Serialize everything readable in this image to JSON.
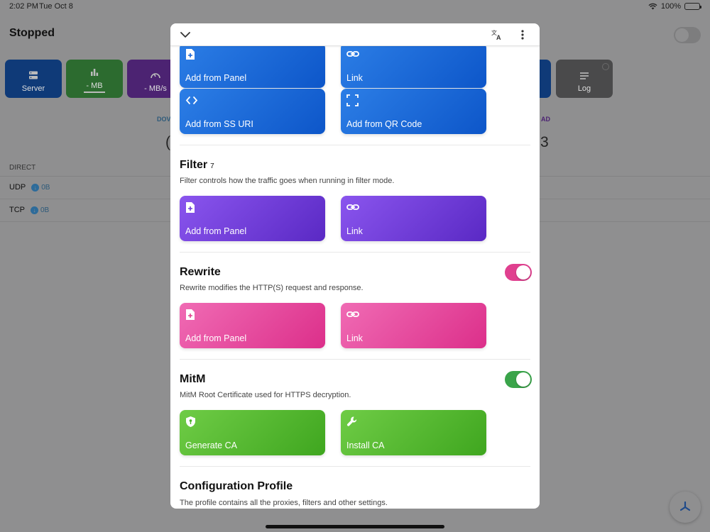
{
  "status_bar": {
    "time": "2:02 PM",
    "date": "Tue Oct 8",
    "battery": "100%"
  },
  "background": {
    "title": "Stopped",
    "tiles": {
      "server": "Server",
      "mb": "- MB",
      "mbs": "- MB/s",
      "log": "Log"
    },
    "download_label": "DOV",
    "upload_label": "AD",
    "big_left": "(",
    "big_right": "3",
    "direct_label": "DIRECT",
    "rows": [
      {
        "name": "UDP",
        "amount": "0B"
      },
      {
        "name": "TCP",
        "amount": "0B"
      }
    ]
  },
  "sheet": {
    "server_buttons": [
      {
        "label": "Add from Panel",
        "icon": "file-plus-icon"
      },
      {
        "label": "Link",
        "icon": "link-icon"
      },
      {
        "label": "Add from SS URI",
        "icon": "code-icon"
      },
      {
        "label": "Add from QR Code",
        "icon": "qr-scan-icon"
      }
    ],
    "filter": {
      "title": "Filter",
      "count": "7",
      "description": "Filter controls how the traffic goes when running in filter mode.",
      "buttons": [
        {
          "label": "Add from Panel",
          "icon": "file-plus-icon"
        },
        {
          "label": "Link",
          "icon": "link-icon"
        }
      ]
    },
    "rewrite": {
      "title": "Rewrite",
      "enabled": true,
      "description": "Rewrite modifies the HTTP(S) request and response.",
      "buttons": [
        {
          "label": "Add from Panel",
          "icon": "file-plus-icon"
        },
        {
          "label": "Link",
          "icon": "link-icon"
        }
      ]
    },
    "mitm": {
      "title": "MitM",
      "enabled": true,
      "description": "MitM Root Certificate used for HTTPS decryption.",
      "buttons": [
        {
          "label": "Generate CA",
          "icon": "shield-key-icon"
        },
        {
          "label": "Install CA",
          "icon": "wrench-icon"
        }
      ]
    },
    "profile": {
      "title": "Configuration Profile",
      "description": "The profile contains all the proxies, filters and other settings."
    }
  },
  "colors": {
    "blue": "#1565d8",
    "purple": "#6b3bd6",
    "pink": "#e0408f",
    "green": "#4db52b"
  }
}
